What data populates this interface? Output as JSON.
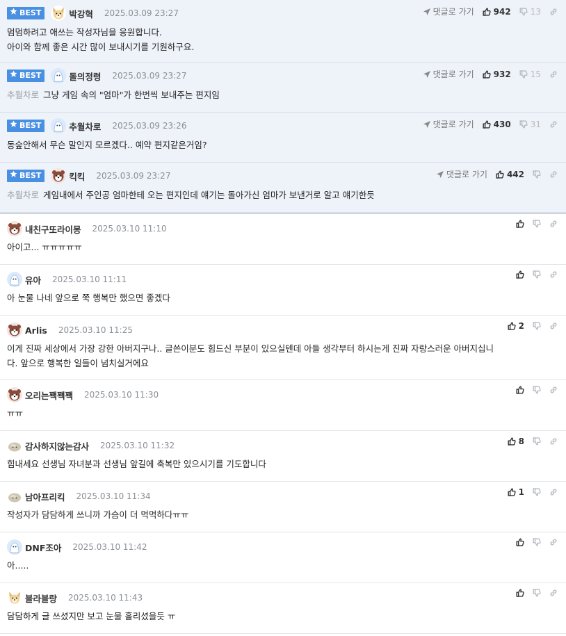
{
  "labels": {
    "best": "BEST",
    "goto_reply": "댓글로 가기"
  },
  "colors": {
    "best_badge": "#4a90e2",
    "best_row_bg": "#eef2f9"
  },
  "best_comments": [
    {
      "nick": "박강혁",
      "date": "2025.03.09 23:27",
      "reply_to": "",
      "lines": [
        "멈멈하려고 애쓰는 작성자님을 응원합니다.",
        "아이와 함께 좋은 시간 많이 보내시기를 기원하구요."
      ],
      "up": "942",
      "down": "13",
      "avatar": "dog-avatar"
    },
    {
      "nick": "돌의정령",
      "date": "2025.03.09 23:27",
      "reply_to": "추월차로",
      "lines": [
        "그냥 게임 속의 \"엄마\"가 한번씩 보내주는 편지임"
      ],
      "up": "932",
      "down": "15",
      "avatar": "ghost-avatar"
    },
    {
      "nick": "추월차로",
      "date": "2025.03.09 23:26",
      "reply_to": "",
      "lines": [
        "동숲안해서 무슨 말인지 모르겠다.. 예약 편지같은거임?"
      ],
      "up": "430",
      "down": "31",
      "avatar": "ghost-avatar"
    },
    {
      "nick": "킥킥",
      "date": "2025.03.09 23:27",
      "reply_to": "추월차로",
      "lines": [
        "게임내에서 주인공 엄마한테 오는 편지인데 얘기는 돌아가신 엄마가 보낸거로 알고 얘기한듯"
      ],
      "up": "442",
      "down": "",
      "avatar": "bear-avatar"
    }
  ],
  "comments": [
    {
      "nick": "내친구또라이몽",
      "date": "2025.03.10 11:10",
      "lines": [
        "아이고... ㅠㅠㅠㅠㅠ"
      ],
      "up": "",
      "avatar": "bear-avatar"
    },
    {
      "nick": "유아",
      "date": "2025.03.10 11:11",
      "lines": [
        "아 눈물 나네 앞으로 쭉 행복만 했으면 좋겠다"
      ],
      "up": "",
      "avatar": "ghost-avatar"
    },
    {
      "nick": "Arlis",
      "date": "2025.03.10 11:25",
      "lines": [
        "이게 진짜 세상에서 가장 강한 아버지구나.. 글쓴이분도 힘드신 부분이 있으실텐데 아들 생각부터 하시는게 진짜 자랑스러운 아버지십니",
        "다. 앞으로 행복한 일들이 넘치실거에요"
      ],
      "up": "2",
      "avatar": "bear-avatar"
    },
    {
      "nick": "오리는꽥꽥꽥",
      "date": "2025.03.10 11:30",
      "lines": [
        "ㅠㅠ"
      ],
      "up": "",
      "avatar": "bear-avatar"
    },
    {
      "nick": "감사하지않는감사",
      "date": "2025.03.10 11:32",
      "lines": [
        "힘내세요 선생님 자녀분과 선생님 앞길에 축복만 있으시기를 기도합니다"
      ],
      "up": "8",
      "avatar": "rock-avatar"
    },
    {
      "nick": "남아프리킥",
      "date": "2025.03.10 11:34",
      "lines": [
        "작성자가 담담하게 쓰니까 가슴이 더 먹먹하다ㅠㅠ"
      ],
      "up": "1",
      "avatar": "rock-avatar"
    },
    {
      "nick": "DNF조아",
      "date": "2025.03.10 11:42",
      "lines": [
        "아....."
      ],
      "up": "",
      "avatar": "ghost-avatar"
    },
    {
      "nick": "블라블랑",
      "date": "2025.03.10 11:43",
      "lines": [
        "담담하게 글 쓰셨지만 보고 눈물 흘리셨을듯 ㅠ"
      ],
      "up": "",
      "avatar": "dog-avatar"
    }
  ]
}
